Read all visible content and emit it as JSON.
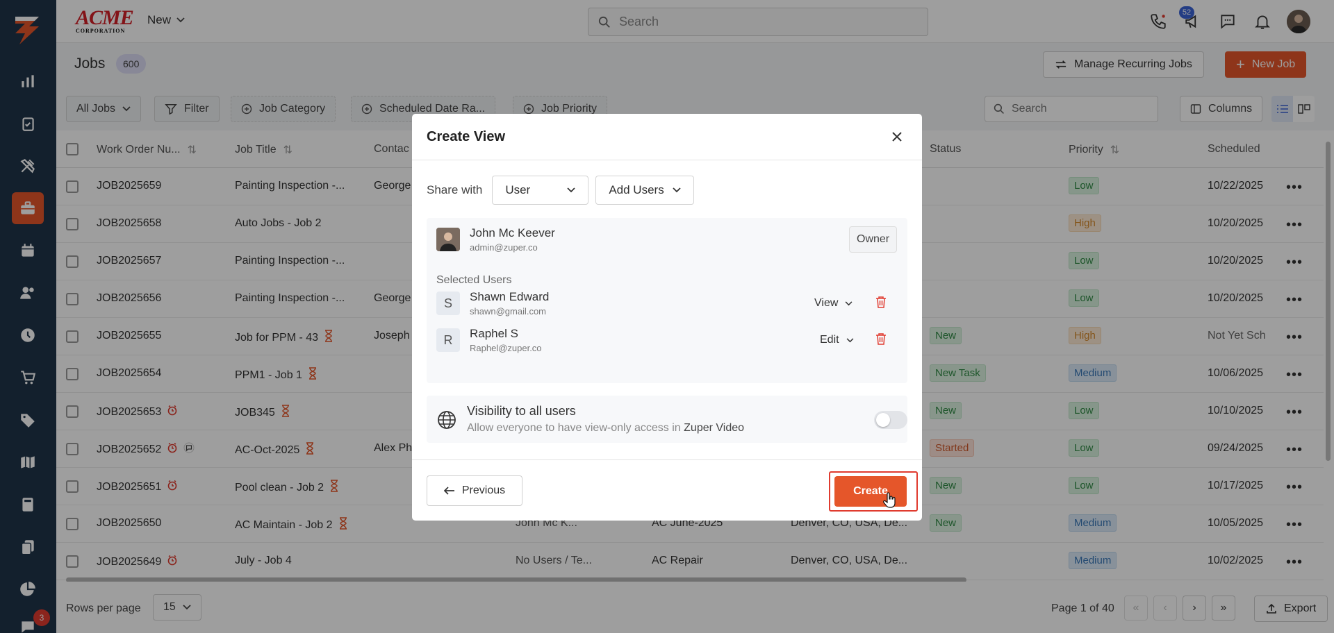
{
  "sidebar": {
    "notification_count": "3"
  },
  "topbar": {
    "brand_main": "ACME",
    "brand_sub": "CORPORATION",
    "new_label": "New",
    "search_placeholder": "Search",
    "notifications_count": "52"
  },
  "page": {
    "title": "Jobs",
    "count": "600",
    "manage_recurring": "Manage Recurring Jobs",
    "new_job": "New Job"
  },
  "filters": {
    "all_jobs": "All Jobs",
    "filter": "Filter",
    "job_category": "Job Category",
    "scheduled_date": "Scheduled Date Ra...",
    "job_priority": "Job Priority",
    "search_placeholder": "Search",
    "columns": "Columns"
  },
  "table": {
    "headers": {
      "work_order": "Work Order Nu...",
      "job_title": "Job Title",
      "contact": "Contac",
      "status": "Status",
      "priority": "Priority",
      "scheduled": "Scheduled"
    },
    "rows": [
      {
        "wo": "JOB2025659",
        "title": "Painting Inspection -...",
        "contact": "George",
        "assigned": "",
        "category": "",
        "address": "",
        "status": "",
        "priority": "Low",
        "sched": "10/22/2025"
      },
      {
        "wo": "JOB2025658",
        "title": "Auto Jobs - Job 2",
        "contact": "",
        "assigned": "",
        "category": "",
        "address": "",
        "status": "",
        "priority": "High",
        "sched": "10/20/2025"
      },
      {
        "wo": "JOB2025657",
        "title": "Painting Inspection -...",
        "contact": "",
        "assigned": "",
        "category": "",
        "address": "",
        "status": "",
        "priority": "Low",
        "sched": "10/20/2025"
      },
      {
        "wo": "JOB2025656",
        "title": "Painting Inspection -...",
        "contact": "George",
        "assigned": "",
        "category": "",
        "address": "",
        "status": "",
        "priority": "Low",
        "sched": "10/20/2025"
      },
      {
        "wo": "JOB2025655",
        "title": "Job for PPM - 43",
        "contact": "Joseph",
        "assigned": "",
        "category": "",
        "address": "",
        "status": "New",
        "priority": "High",
        "sched": "Not Yet Sch"
      },
      {
        "wo": "JOB2025654",
        "title": "PPM1 - Job 1",
        "contact": "",
        "assigned": "",
        "category": "",
        "address": "",
        "status": "New Task",
        "priority": "Medium",
        "sched": "10/06/2025"
      },
      {
        "wo": "JOB2025653",
        "title": "JOB345",
        "contact": "",
        "assigned": "",
        "category": "",
        "address": "",
        "status": "New",
        "priority": "Low",
        "sched": "10/10/2025"
      },
      {
        "wo": "JOB2025652",
        "title": "AC-Oct-2025",
        "contact": "Alex Ph",
        "assigned": "",
        "category": "",
        "address": "",
        "status": "Started",
        "priority": "Low",
        "sched": "09/24/2025"
      },
      {
        "wo": "JOB2025651",
        "title": "Pool clean - Job 2",
        "contact": "",
        "assigned": "",
        "category": "",
        "address": "",
        "status": "New",
        "priority": "Low",
        "sched": "10/17/2025"
      },
      {
        "wo": "JOB2025650",
        "title": "AC Maintain - Job 2",
        "contact": "",
        "assigned": "John Mc K...",
        "category": "AC June-2025",
        "address": "Denver, CO, USA, De...",
        "status": "New",
        "priority": "Medium",
        "sched": "10/05/2025"
      },
      {
        "wo": "JOB2025649",
        "title": "July - Job 4",
        "contact": "",
        "assigned": "No Users / Te...",
        "category": "AC Repair",
        "address": "Denver, CO, USA, De...",
        "status": "",
        "priority": "Medium",
        "sched": "10/02/2025"
      }
    ]
  },
  "footer": {
    "rows_per_page_label": "Rows per page",
    "rows_per_page": "15",
    "page_info": "Page 1 of 40",
    "export": "Export"
  },
  "modal": {
    "title": "Create View",
    "share_with_label": "Share with",
    "share_with_value": "User",
    "add_users": "Add Users",
    "owner": {
      "name": "John Mc Keever",
      "email": "admin@zuper.co",
      "tag": "Owner"
    },
    "selected_users_label": "Selected Users",
    "users": [
      {
        "initial": "S",
        "name": "Shawn Edward",
        "email": "shawn@gmail.com",
        "permission": "View"
      },
      {
        "initial": "R",
        "name": "Raphel S",
        "email": "Raphel@zuper.co",
        "permission": "Edit"
      }
    ],
    "visibility_title": "Visibility to all users",
    "visibility_sub": "Allow everyone to have view-only access in",
    "visibility_app": "Zuper Video",
    "visibility_enabled": false,
    "previous": "Previous",
    "create": "Create"
  },
  "colors": {
    "accent": "#e5562a",
    "sidebar": "#1f3449"
  }
}
